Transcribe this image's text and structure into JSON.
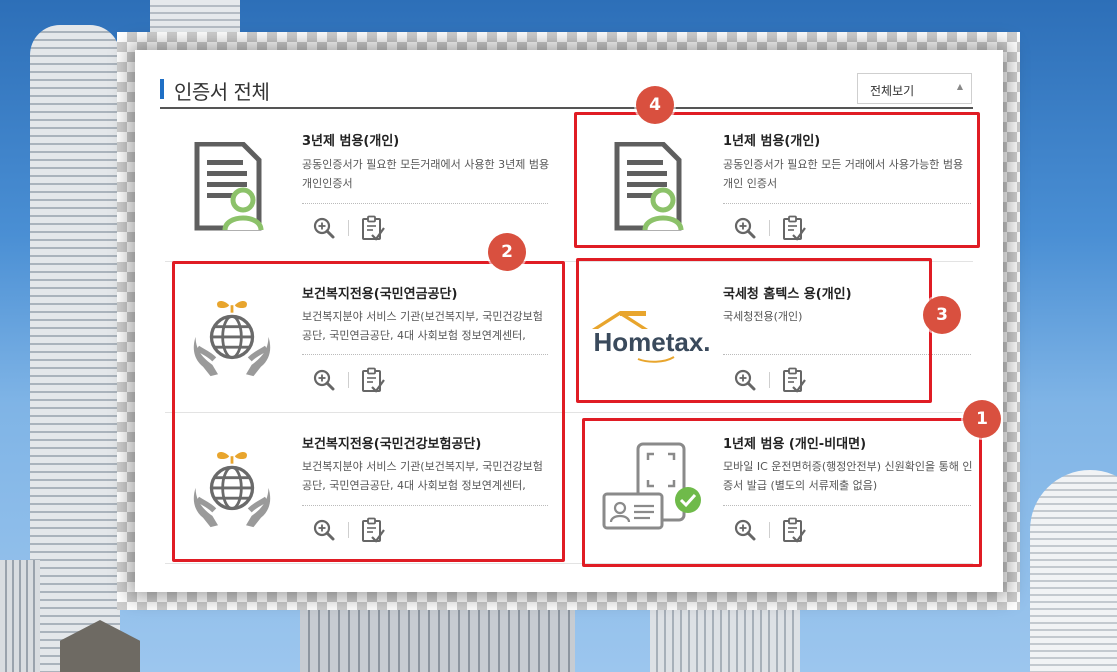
{
  "section": {
    "title": "인증서 전체",
    "view_select": "전체보기"
  },
  "cards": [
    {
      "name": "3년제 범용(개인)",
      "desc": "공동인증서가 필요한 모든거래에서 사용한 3년제 범용개인인증서",
      "icon": "certificate-user-icon"
    },
    {
      "name": "1년제 범용(개인)",
      "desc": "공동인증서가 필요한 모든 거래에서 사용가능한 범용개인 인증서",
      "icon": "certificate-user-icon"
    },
    {
      "name": "보건복지전용(국민연금공단)",
      "desc": "보건복지분야 서비스 기관(보건복지부, 국민건강보험공단, 국민연금공단, 4대 사회보험 정보연계센터,",
      "icon": "globe-hands-icon"
    },
    {
      "name": "국세청 홈텍스 용(개인)",
      "desc": "국세청전용(개인)",
      "icon": "hometax-logo",
      "logo_text": "Hometax."
    },
    {
      "name": "보건복지전용(국민건강보험공단)",
      "desc": "보건복지분야 서비스 기관(보건복지부, 국민건강보험공단, 국민연금공단, 4대 사회보험 정보연계센터,",
      "icon": "globe-hands-icon"
    },
    {
      "name": "1년제 범용 (개인-비대면)",
      "desc": "모바일 IC 운전면허증(행정안전부) 신원확인을 통해 인증서 발급 (별도의 서류제출 없음)",
      "icon": "mobile-id-check-icon"
    }
  ],
  "badges": [
    "4",
    "2",
    "3",
    "1"
  ],
  "colors": {
    "accent": "#1f6fc5",
    "highlight": "#e01c24",
    "badge": "#d9503f",
    "user_icon": "#8cc26a"
  }
}
